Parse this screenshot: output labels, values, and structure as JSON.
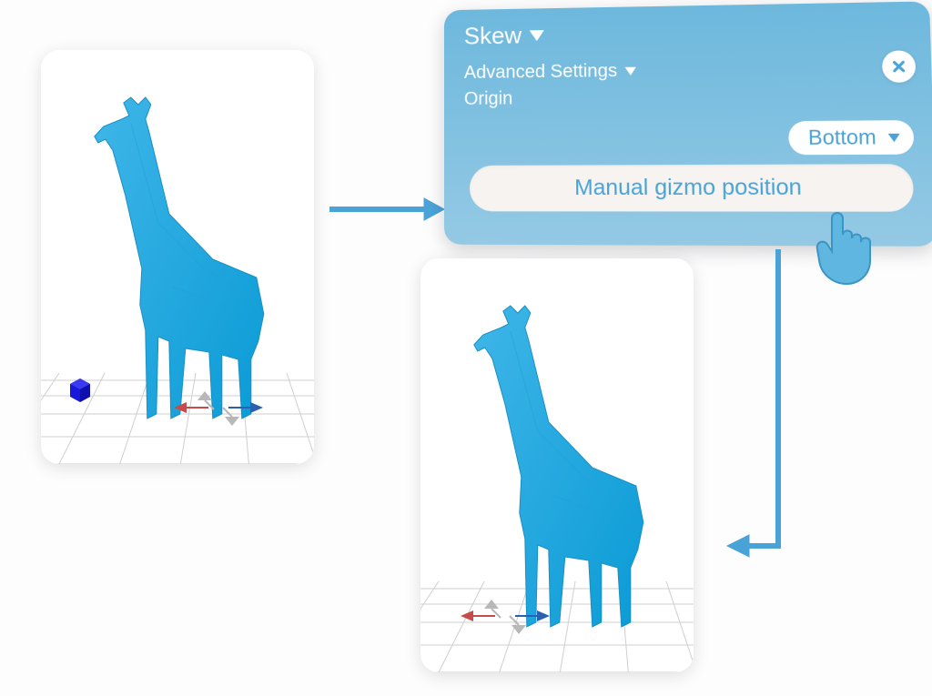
{
  "panel": {
    "title": "Skew",
    "advanced_label": "Advanced Settings",
    "origin_label": "Origin",
    "origin_value": "Bottom",
    "manual_button": "Manual gizmo position"
  },
  "icons": {
    "close": "close-icon",
    "hand": "pointing-hand-icon",
    "triangle": "triangle-down-icon"
  }
}
